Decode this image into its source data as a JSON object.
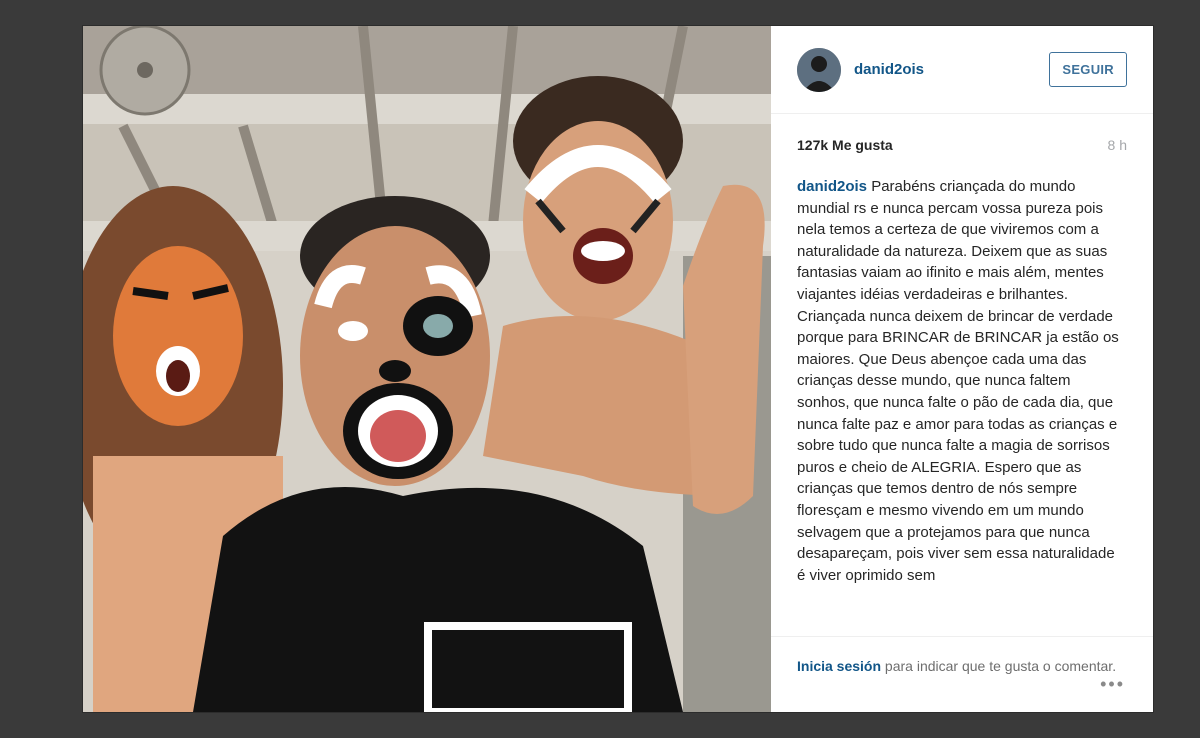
{
  "header": {
    "username": "danid2ois",
    "follow_label": "SEGUIR"
  },
  "stats": {
    "likes": "127k Me gusta",
    "time": "8 h"
  },
  "caption": {
    "username": "danid2ois",
    "text": "Parabéns criançada do mundo mundial rs e nunca percam vossa pureza pois nela temos a certeza de que viviremos com a naturalidade da natureza. Deixem que as suas fantasias vaiam ao ifinito e mais além, mentes viajantes idéias verdadeiras e brilhantes. Criançada nunca deixem de brincar de verdade porque para BRINCAR de BRINCAR ja estão os maiores. Que Deus abençoe cada uma das crianças desse mundo, que nunca faltem sonhos, que nunca falte o pão de cada dia, que nunca falte paz e amor para todas as crianças e sobre tudo que nunca falte a magia de sorrisos puros e cheio de ALEGRIA. Espero que as crianças que temos dentro de nós sempre floresçam e mesmo vivendo em um mundo selvagem que a protejamos para que nunca desapareçam, pois viver sem essa naturalidade é viver oprimido sem"
  },
  "footer": {
    "login_link": "Inicia sesión",
    "rest_text": " para indicar que te gusta o comentar.",
    "more_icon": "ellipsis-icon"
  },
  "colors": {
    "link": "#125688",
    "button": "#3f729b",
    "backdrop": "#3a3a3a"
  }
}
